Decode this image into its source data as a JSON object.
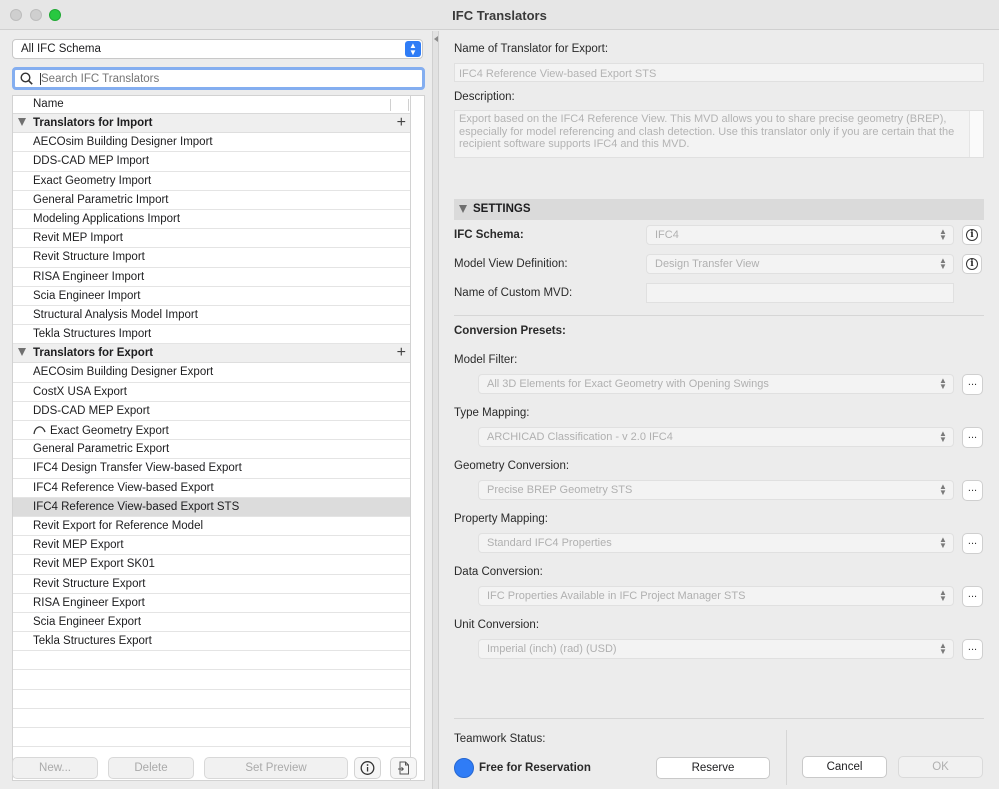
{
  "window": {
    "title": "IFC Translators"
  },
  "left": {
    "schema_filter": "All IFC Schema",
    "search_placeholder": "Search IFC Translators",
    "column_name": "Name",
    "groups": [
      {
        "label": "Translators for Import",
        "items": [
          "AECOsim Building Designer Import",
          "DDS-CAD MEP Import",
          "Exact Geometry Import",
          "General Parametric Import",
          "Modeling Applications Import",
          "Revit MEP Import",
          "Revit Structure Import",
          "RISA Engineer Import",
          "Scia Engineer Import",
          "Structural Analysis Model Import",
          "Tekla Structures Import"
        ]
      },
      {
        "label": "Translators for Export",
        "items": [
          "AECOsim Building Designer Export",
          "CostX USA Export",
          "DDS-CAD MEP Export",
          "Exact Geometry Export",
          "General Parametric Export",
          "IFC4 Design Transfer View-based Export",
          "IFC4 Reference View-based Export",
          "IFC4 Reference View-based Export STS",
          "Revit Export for Reference Model",
          "Revit MEP Export",
          "Revit MEP Export SK01",
          "Revit Structure Export",
          "RISA Engineer Export",
          "Scia Engineer Export",
          "Tekla Structures Export"
        ]
      }
    ],
    "selected_item": "IFC4 Reference View-based Export STS",
    "buttons": {
      "new": "New...",
      "delete": "Delete",
      "set_preview": "Set Preview"
    }
  },
  "right": {
    "name_label": "Name of Translator for Export:",
    "name_value": "IFC4 Reference View-based Export STS",
    "description_label": "Description:",
    "description_value": "Export based on the IFC4 Reference View. This MVD allows you to share precise geometry (BREP), especially for model referencing and clash detection. Use this translator only if you are certain that the recipient software supports IFC4 and this MVD.",
    "settings_header": "SETTINGS",
    "ifc_schema_label": "IFC Schema:",
    "ifc_schema_value": "IFC4",
    "mvd_label": "Model View Definition:",
    "mvd_value": "Design Transfer View",
    "custom_mvd_label": "Name of Custom MVD:",
    "custom_mvd_value": "",
    "presets_header": "Conversion Presets:",
    "model_filter_label": "Model Filter:",
    "model_filter_value": "All 3D Elements for Exact Geometry with Opening Swings",
    "type_mapping_label": "Type Mapping:",
    "type_mapping_value": "ARCHICAD Classification - v 2.0 IFC4",
    "geometry_label": "Geometry Conversion:",
    "geometry_value": "Precise BREP Geometry STS",
    "property_label": "Property Mapping:",
    "property_value": "Standard IFC4 Properties",
    "data_label": "Data Conversion:",
    "data_value": "IFC Properties Available in IFC Project Manager STS",
    "unit_label": "Unit Conversion:",
    "unit_value": "Imperial (inch) (rad) (USD)",
    "more_label": "...",
    "teamwork_label": "Teamwork Status:",
    "teamwork_value": "Free for Reservation",
    "reserve_button": "Reserve",
    "cancel_button": "Cancel",
    "ok_button": "OK"
  },
  "colors": {
    "accent": "#2f7cf6",
    "selection": "#dcdcdc"
  }
}
